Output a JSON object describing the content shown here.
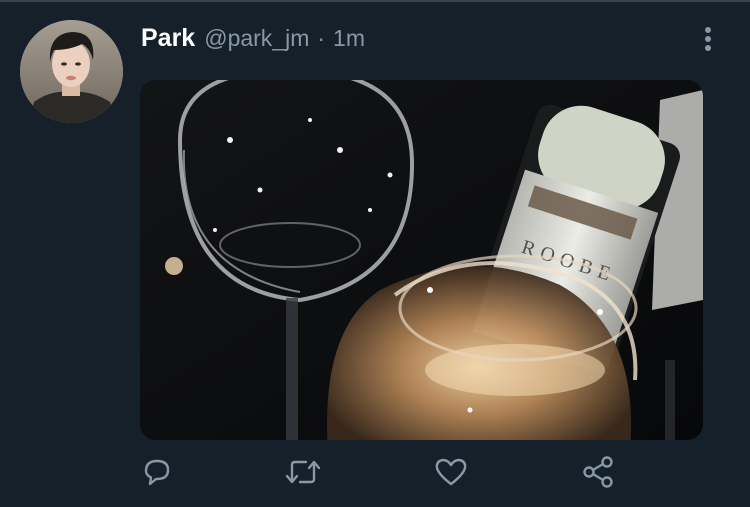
{
  "tweet": {
    "author": {
      "name": "Park",
      "handle": "@park_jm",
      "separator": "·",
      "time": "1m"
    },
    "media": {
      "bottle_label": "ROOBE"
    },
    "icons": {
      "more": "more-vertical-icon",
      "reply": "reply-icon",
      "retweet": "retweet-icon",
      "like": "heart-icon",
      "share": "share-icon"
    }
  },
  "colors": {
    "background": "#15202b",
    "name": "#ffffff",
    "secondary_text": "#8899a6",
    "divider": "#38444d"
  }
}
